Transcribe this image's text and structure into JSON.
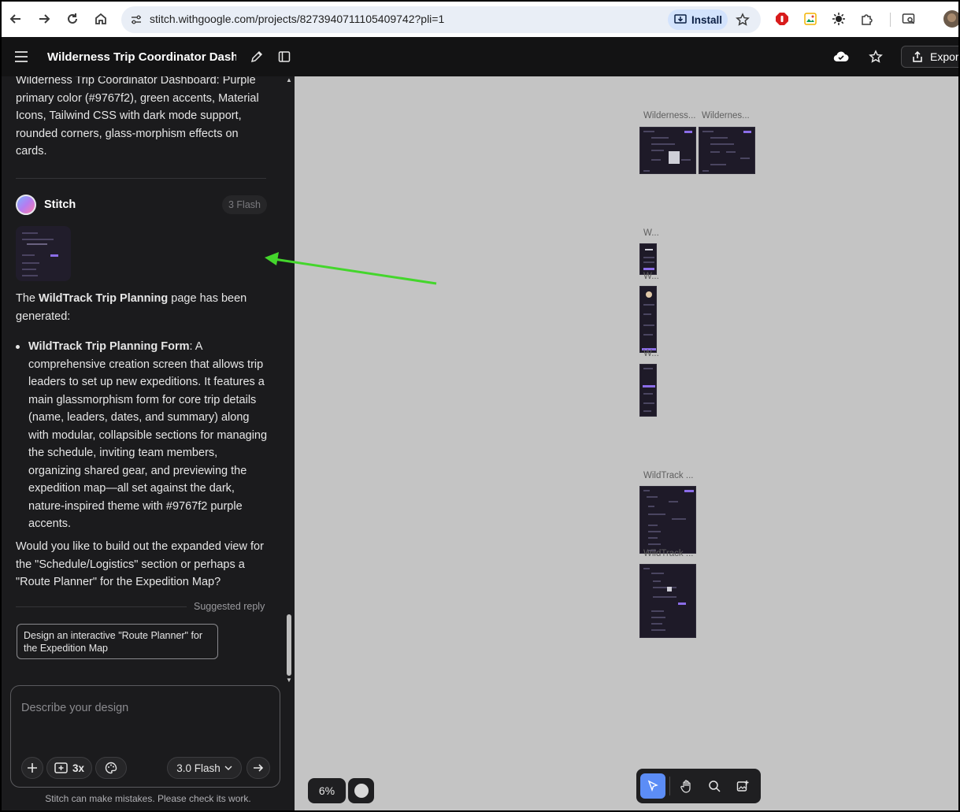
{
  "browser": {
    "url": "stitch.withgoogle.com/projects/8273940711105409742?pli=1",
    "install_label": "Install"
  },
  "app": {
    "project_title": "Wilderness Trip Coordinator Dashboard",
    "export_label": "Export"
  },
  "chat": {
    "prompt_text": "Wilderness Trip Coordinator Dashboard: Purple primary color (#9767f2), green accents, Material Icons, Tailwind CSS with dark mode support, rounded corners, glass-morphism effects on cards.",
    "sender": "Stitch",
    "model_badge": "3 Flash",
    "message_intro_pre": "The ",
    "message_intro_bold": "WildTrack Trip Planning",
    "message_intro_post": " page has been generated:",
    "bullet_bold": "WildTrack Trip Planning Form",
    "bullet_text": ": A comprehensive creation screen that allows trip leaders to set up new expeditions. It features a main glassmorphism form for core trip details (name, leaders, dates, and summary) along with modular, collapsible sections for managing the schedule, inviting team members, organizing shared gear, and previewing the expedition map—all set against the dark, nature-inspired theme with #9767f2 purple accents.",
    "followup": "Would you like to build out the expanded view for the \"Schedule/Logistics\" section or perhaps a \"Route Planner\" for the Expedition Map?",
    "suggested_label": "Suggested reply",
    "suggestion": "Design an interactive \"Route Planner\" for the Expedition Map",
    "composer_placeholder": "Describe your design",
    "variant_count": "3x",
    "model_select": "3.0 Flash",
    "disclaimer": "Stitch can make mistakes. Please check its work."
  },
  "canvas": {
    "zoom": "6%",
    "screens": [
      {
        "label": "Wilderness..."
      },
      {
        "label": "Wildernes..."
      },
      {
        "label": "W..."
      },
      {
        "label": "W..."
      },
      {
        "label": "W..."
      },
      {
        "label": "WildTrack ..."
      },
      {
        "label": "WildTrack ..."
      }
    ]
  },
  "icons": {
    "back": "back-arrow-icon",
    "forward": "forward-arrow-icon",
    "reload": "reload-icon",
    "home": "home-icon",
    "star": "star-icon",
    "menu": "hamburger-menu-icon",
    "edit": "pencil-icon",
    "panel": "panel-toggle-icon",
    "cloud": "cloud-check-icon",
    "share": "share-upload-icon"
  },
  "colors": {
    "accent": "#9767f2",
    "arrow": "#44d62c",
    "tool_active": "#5c8df6"
  }
}
